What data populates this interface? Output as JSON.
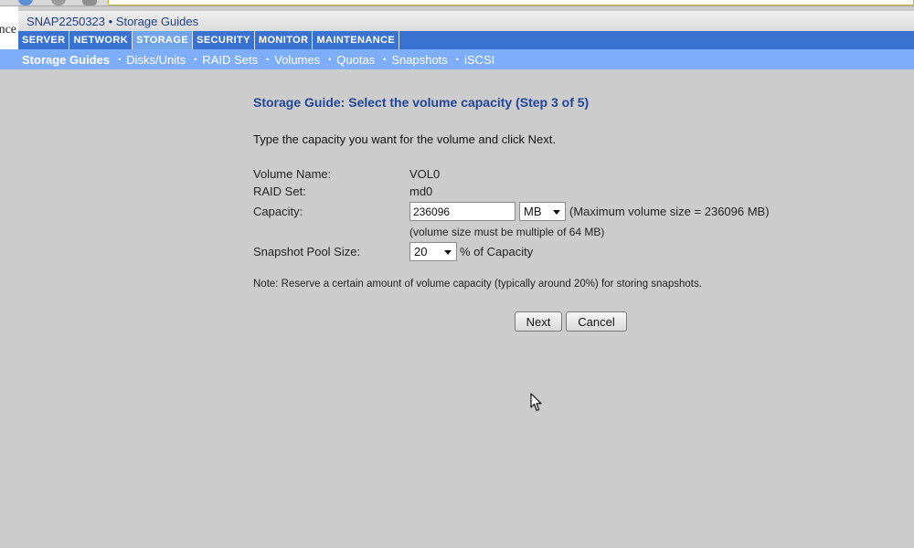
{
  "app": {
    "title": "SNAP2250323 • Storage Guides",
    "left_edge_text": "nce"
  },
  "main_nav": {
    "tabs": [
      {
        "label": "SERVER",
        "active": false
      },
      {
        "label": "NETWORK",
        "active": false
      },
      {
        "label": "STORAGE",
        "active": true
      },
      {
        "label": "SECURITY",
        "active": false
      },
      {
        "label": "MONITOR",
        "active": false
      },
      {
        "label": "MAINTENANCE",
        "active": false
      }
    ]
  },
  "sub_nav": {
    "items": [
      {
        "label": "Storage Guides",
        "active": true
      },
      {
        "label": "Disks/Units",
        "active": false
      },
      {
        "label": "RAID Sets",
        "active": false
      },
      {
        "label": "Volumes",
        "active": false
      },
      {
        "label": "Quotas",
        "active": false
      },
      {
        "label": "Snapshots",
        "active": false
      },
      {
        "label": "iSCSI",
        "active": false
      }
    ],
    "separator": "•"
  },
  "form": {
    "title": "Storage Guide: Select the volume capacity (Step 3 of 5)",
    "instruction": "Type the capacity you want for the volume and click Next.",
    "volume_name_label": "Volume Name:",
    "volume_name_value": "VOL0",
    "raid_set_label": "RAID Set:",
    "raid_set_value": "md0",
    "capacity_label": "Capacity:",
    "capacity_value": "236096",
    "capacity_unit": "MB",
    "max_volume_note": "(Maximum volume size = 236096 MB)",
    "capacity_hint": "(volume size must be multiple of 64 MB)",
    "snapshot_pool_label": "Snapshot Pool Size:",
    "snapshot_pool_value": "20",
    "snapshot_pool_suffix": "% of Capacity",
    "note": "Note: Reserve a certain amount of volume capacity (typically around 20%) for storing snapshots.",
    "next_button": "Next",
    "cancel_button": "Cancel"
  },
  "colors": {
    "page_background": "#cccccc",
    "nav_blue": "#3a72d2",
    "nav_active": "#72a4ea",
    "sub_nav_blue": "#7eaefb",
    "title_blue": "#21459b"
  }
}
